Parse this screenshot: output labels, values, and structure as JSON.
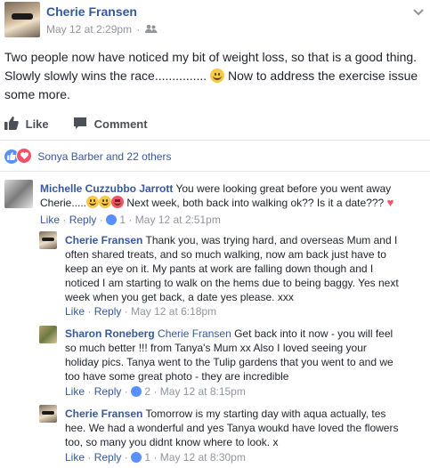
{
  "post": {
    "author": "Cherie Fransen",
    "time": "May 12 at 2:29pm",
    "separator": "·",
    "text": "Two people now have noticed my bit of weight loss, so that is a good thing. Slowly slowly wins the race...............",
    "text_after_emoji": "Now to address the exercise issue some more.",
    "menu_icon": "chevron-down-icon",
    "audience_icon": "friends-icon"
  },
  "actions": {
    "like": "Like",
    "comment": "Comment"
  },
  "reactions": {
    "summary": "Sonya Barber and 22 others"
  },
  "comments": [
    {
      "author": "Michelle Cuzzubbo Jarrott",
      "text_1": "You were looking great before you went away",
      "text_2a": "Cherie.....",
      "text_2b": "Next week, both back into walking ok?? Is it a date???",
      "like": "Like",
      "reply": "Reply",
      "sep": "·",
      "like_count": "1",
      "time": "May 12 at 2:51pm"
    },
    {
      "author": "Cherie Fransen",
      "lines": [
        "Thank you, was trying hard, and overseas Mum and I",
        "often shared treats, and so much walking, now am back just have to",
        "keep an eye on it. My pants at work are falling down though and I",
        "noticed I am starting to walk on the hems due to being baggy. Yes next",
        "week when you get back, a date yes please. xxx"
      ],
      "like": "Like",
      "reply": "Reply",
      "sep": "·",
      "time": "May 12 at 6:18pm"
    },
    {
      "author": "Sharon Roneberg",
      "mention": "Cherie Fransen",
      "lines": [
        "Get back into it now - you will feel",
        "so much better !!! from Tanya's Mum xx Also I loved seeing your",
        "holiday pics. Tanya went to the Tulip gardens that you went to and we",
        "too have some great photo - they are incredible"
      ],
      "like": "Like",
      "reply": "Reply",
      "sep": "·",
      "like_count": "2",
      "time": "May 12 at 8:15pm"
    },
    {
      "author": "Cherie Fransen",
      "lines": [
        "Tomorrow is my starting day with aqua actually, tes",
        "hee. We had a wonderful and yes Tanya woukd have loved the flowers",
        "too, so many you didnt know where to look. x"
      ],
      "like": "Like",
      "reply": "Reply",
      "sep": "·",
      "like_count": "1",
      "time": "May 12 at 8:30pm"
    }
  ],
  "colors": {
    "link": "#365899",
    "meta": "#90949c",
    "like_blue": "#5890ff",
    "love_red": "#f25268"
  }
}
